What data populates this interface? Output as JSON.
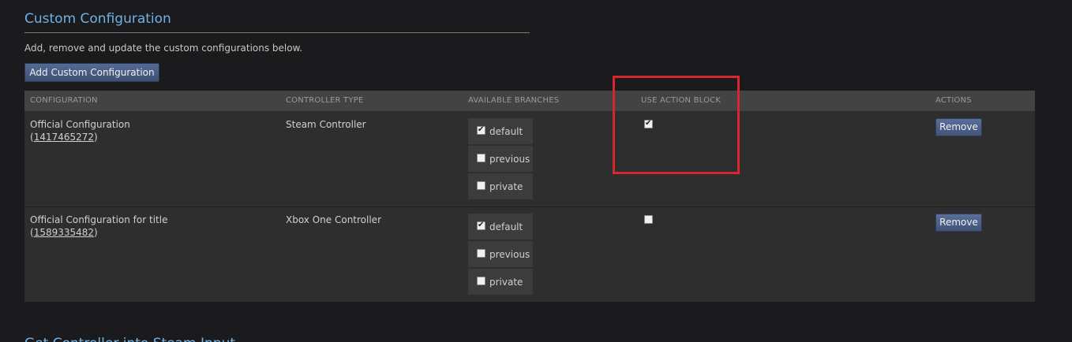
{
  "section": {
    "title": "Custom Configuration",
    "description": "Add, remove and update the custom configurations below.",
    "add_button_label": "Add Custom Configuration"
  },
  "table": {
    "headers": {
      "configuration": "CONFIGURATION",
      "controller_type": "CONTROLLER TYPE",
      "available_branches": "AVAILABLE BRANCHES",
      "use_action_block": "USE ACTION BLOCK",
      "actions": "ACTIONS"
    },
    "rows": [
      {
        "name": "Official Configuration",
        "id_open": "(",
        "id": "1417465272",
        "id_close": ")",
        "controller_type": "Steam Controller",
        "branches": [
          {
            "label": "default",
            "checked": true
          },
          {
            "label": "previous",
            "checked": false
          },
          {
            "label": "private",
            "checked": false
          }
        ],
        "use_action_block": true,
        "remove_label": "Remove"
      },
      {
        "name": "Official Configuration for title",
        "id_open": "(",
        "id": "1589335482",
        "id_close": ")",
        "controller_type": "Xbox One Controller",
        "branches": [
          {
            "label": "default",
            "checked": true
          },
          {
            "label": "previous",
            "checked": false
          },
          {
            "label": "private",
            "checked": false
          }
        ],
        "use_action_block": false,
        "remove_label": "Remove"
      }
    ]
  },
  "next_section_title": "Get Controller into Steam Input",
  "colors": {
    "accent_title": "#6fb2e6",
    "highlight": "#d8262e",
    "button": "#4a5d84"
  }
}
